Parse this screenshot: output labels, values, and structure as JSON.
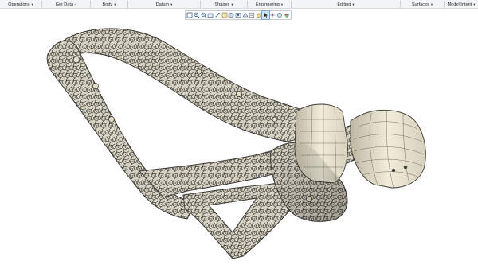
{
  "ribbon": {
    "groups": [
      {
        "label": "Operations",
        "caret": "▾"
      },
      {
        "label": "Get Data",
        "caret": "▾"
      },
      {
        "label": "Body",
        "caret": "▾"
      },
      {
        "label": "Datum",
        "caret": "▾"
      },
      {
        "label": "Shapes",
        "caret": "▾"
      },
      {
        "label": "Engineering",
        "caret": "▾"
      },
      {
        "label": "Editing",
        "caret": "▾"
      },
      {
        "label": "Surfaces",
        "caret": "▾"
      },
      {
        "label": "Model Intent",
        "caret": "▾"
      }
    ]
  },
  "view_toolbar": {
    "buttons": [
      {
        "icon": "refit-icon"
      },
      {
        "icon": "zoom-in-icon"
      },
      {
        "icon": "zoom-out-icon"
      },
      {
        "icon": "repaint-icon"
      },
      {
        "icon": "saved-orientations-icon"
      },
      {
        "icon": "view-manager-icon"
      },
      {
        "icon": "display-style-icon"
      },
      {
        "icon": "perspective-icon"
      },
      {
        "icon": "section-icon"
      },
      {
        "icon": "annotation-display-icon"
      },
      {
        "icon": "datum-display-icon"
      },
      {
        "icon": "select-filter-icon",
        "active": true
      },
      {
        "icon": "spin-center-icon"
      },
      {
        "icon": "render-options-icon"
      },
      {
        "icon": "appearance-icon"
      }
    ]
  },
  "colors": {
    "lattice": "#d8d3c3",
    "lattice_stroke": "#3b3a36",
    "solid_body": "#e8e2cc",
    "ribbon_bg": "#f3f4f6"
  }
}
